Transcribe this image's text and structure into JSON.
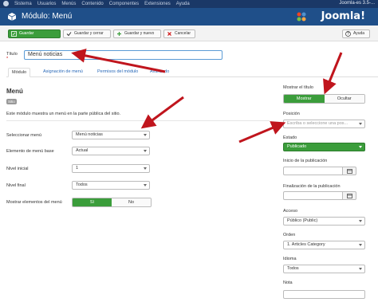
{
  "topbar": {
    "menu": [
      "Sistema",
      "Usuarios",
      "Menús",
      "Contenido",
      "Componentes",
      "Extensiones",
      "Ayuda"
    ],
    "site": "Joomla-es 3.5-..."
  },
  "header": {
    "title": "Módulo: Menú",
    "brand": "Joomla!"
  },
  "toolbar": {
    "save": "Guardar",
    "save_close": "Guardar y cerrar",
    "save_new": "Guardar y nuevo",
    "cancel": "Cancelar",
    "help": "Ayuda"
  },
  "form": {
    "title_label": "Título",
    "title_required": "*",
    "title_value": "Menú noticias"
  },
  "tabs": [
    "Módulo",
    "Asignación de menú",
    "Permisos del módulo",
    "Avanzado"
  ],
  "module": {
    "heading": "Menú",
    "badge": "Sitio",
    "description": "Este módulo muestra un menú en la parte pública del sitio."
  },
  "fields": {
    "menu_label": "Seleccionar menú",
    "menu_value": "Menú noticias",
    "base_label": "Elemento de menú base",
    "base_value": "Actual",
    "start_label": "Nivel inicial",
    "start_value": "1",
    "end_label": "Nivel final",
    "end_value": "Todos",
    "sub_label": "Mostrar elementos del menú",
    "sub_on": "Sí",
    "sub_off": "No"
  },
  "sidebar": {
    "show_title_label": "Mostrar el título",
    "show": "Mostrar",
    "hide": "Ocultar",
    "position_label": "Posición",
    "position_placeholder": "Escriba o seleccione una pos...",
    "status_label": "Estado",
    "status_value": "Publicado",
    "publish_up_label": "Inicio de la publicación",
    "publish_down_label": "Finalización de la publicación",
    "access_label": "Acceso",
    "access_value": "Público (Public)",
    "order_label": "Orden",
    "order_value": "1. Articles Category",
    "language_label": "Idioma",
    "language_value": "Todos",
    "note_label": "Nota"
  },
  "colors": {
    "topbar": "#1a3867",
    "header": "#1f4f89",
    "success": "#3b9d3b",
    "annotation_arrow": "#c0151d"
  }
}
